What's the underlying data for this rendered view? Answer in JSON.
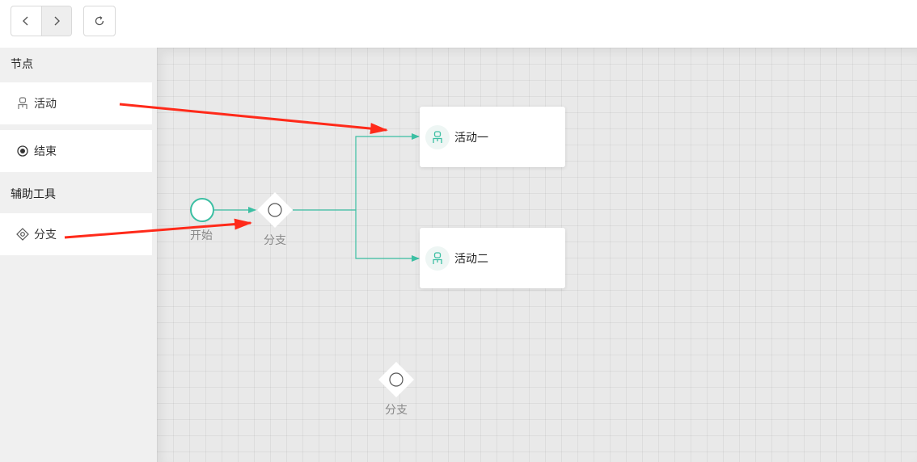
{
  "toolbar": {
    "back_icon": "chevron-left-icon",
    "forward_icon": "chevron-right-icon",
    "refresh_icon": "refresh-icon"
  },
  "sidebar": {
    "sections": [
      {
        "title": "节点",
        "items": [
          {
            "label": "活动",
            "icon": "person-icon"
          },
          {
            "label": "结束",
            "icon": "end-circle-icon"
          }
        ]
      },
      {
        "title": "辅助工具",
        "items": [
          {
            "label": "分支",
            "icon": "diamond-icon"
          }
        ]
      }
    ]
  },
  "canvas": {
    "start_node": {
      "label": "开始"
    },
    "branch_nodes": [
      {
        "label": "分支"
      },
      {
        "label": "分支"
      }
    ],
    "activity_nodes": [
      {
        "label": "活动一",
        "icon": "person-icon"
      },
      {
        "label": "活动二",
        "icon": "person-icon"
      }
    ]
  },
  "colors": {
    "accent": "#3cbfa3",
    "annotation_arrow": "#ff2a1a",
    "canvas_bg": "#e9e9e9",
    "sidebar_bg": "#f0f0f0"
  }
}
